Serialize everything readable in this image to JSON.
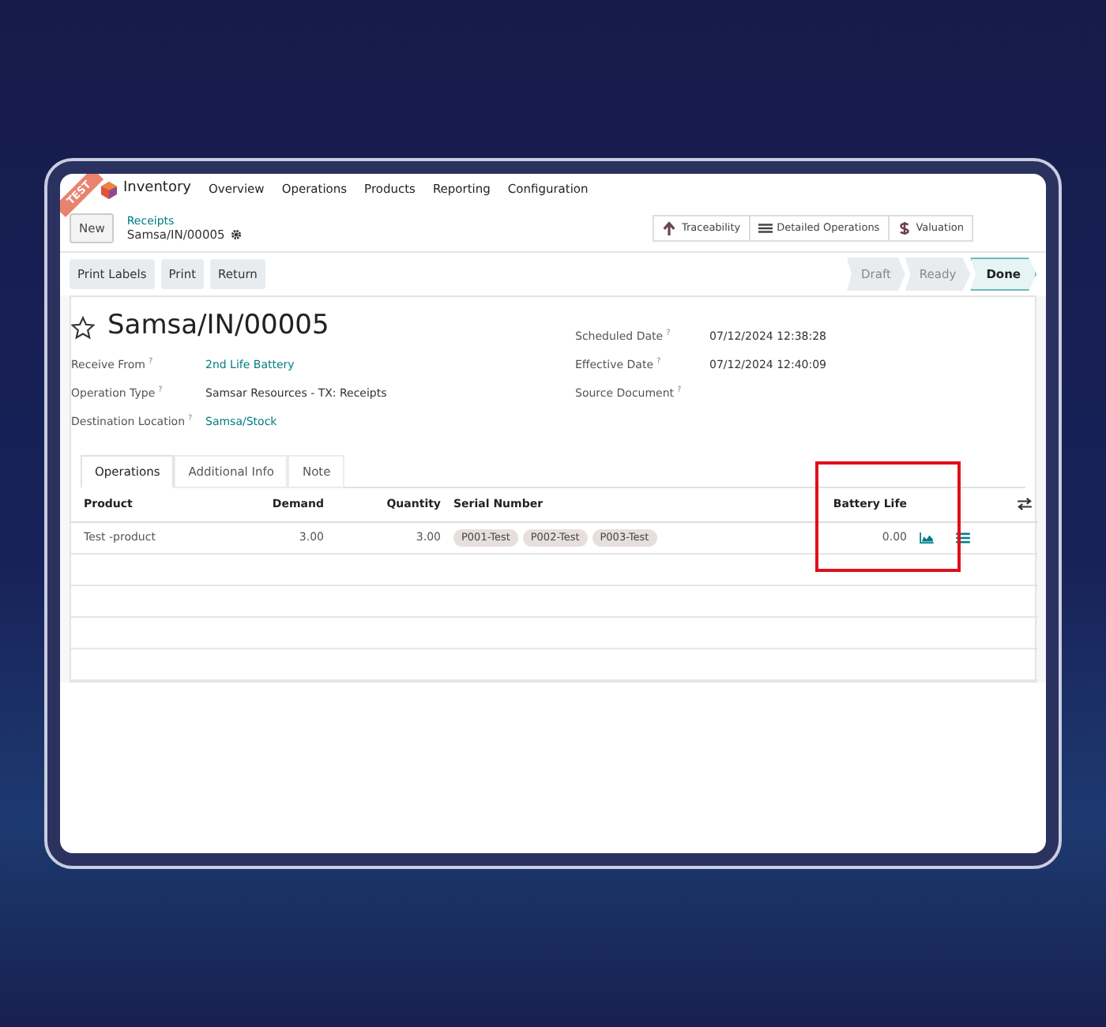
{
  "navbar": {
    "app_name": "Inventory",
    "menu": [
      "Overview",
      "Operations",
      "Products",
      "Reporting",
      "Configuration"
    ]
  },
  "ribbon": {
    "text": "TEST"
  },
  "control_panel": {
    "new_button": "New",
    "breadcrumb": "Receipts",
    "record": "Samsa/IN/00005",
    "smart_buttons": [
      {
        "kind": "arrow",
        "label": "Traceability"
      },
      {
        "kind": "list",
        "label": "Detailed Operations"
      },
      {
        "kind": "dollar",
        "label": "Valuation"
      }
    ]
  },
  "actions": [
    "Print Labels",
    "Print",
    "Return"
  ],
  "status_steps": [
    {
      "label": "Draft",
      "selected": false
    },
    {
      "label": "Ready",
      "selected": false
    },
    {
      "label": "Done",
      "selected": true
    }
  ],
  "record": {
    "title": "Samsa/IN/00005",
    "favorite": false,
    "left_fields": [
      {
        "label": "Receive From",
        "help": "?",
        "value": "2nd Life Battery",
        "link": true
      },
      {
        "label": "Operation Type",
        "help": "?",
        "value": "Samsar Resources - TX: Receipts",
        "link": false
      },
      {
        "label": "Destination Location",
        "help": "?",
        "value": "Samsa/Stock",
        "link": true
      }
    ],
    "right_fields": [
      {
        "label": "Scheduled Date",
        "help": "?",
        "value": "07/12/2024 12:38:28"
      },
      {
        "label": "Effective Date",
        "help": "?",
        "value": "07/12/2024 12:40:09"
      },
      {
        "label": "Source Document",
        "help": "?"
      }
    ]
  },
  "tabs": [
    {
      "label": "Operations",
      "selected": true
    },
    {
      "label": "Additional Info",
      "selected": false
    },
    {
      "label": "Note",
      "selected": false
    }
  ],
  "table": {
    "columns": [
      "Product",
      "Demand",
      "Quantity",
      "Serial Number",
      "Battery Life"
    ],
    "rows": [
      {
        "product": "Test -product",
        "demand": "3.00",
        "quantity": "3.00",
        "serials": [
          "P001-Test",
          "P002-Test",
          "P003-Test"
        ],
        "battery_life": "0.00"
      }
    ]
  }
}
